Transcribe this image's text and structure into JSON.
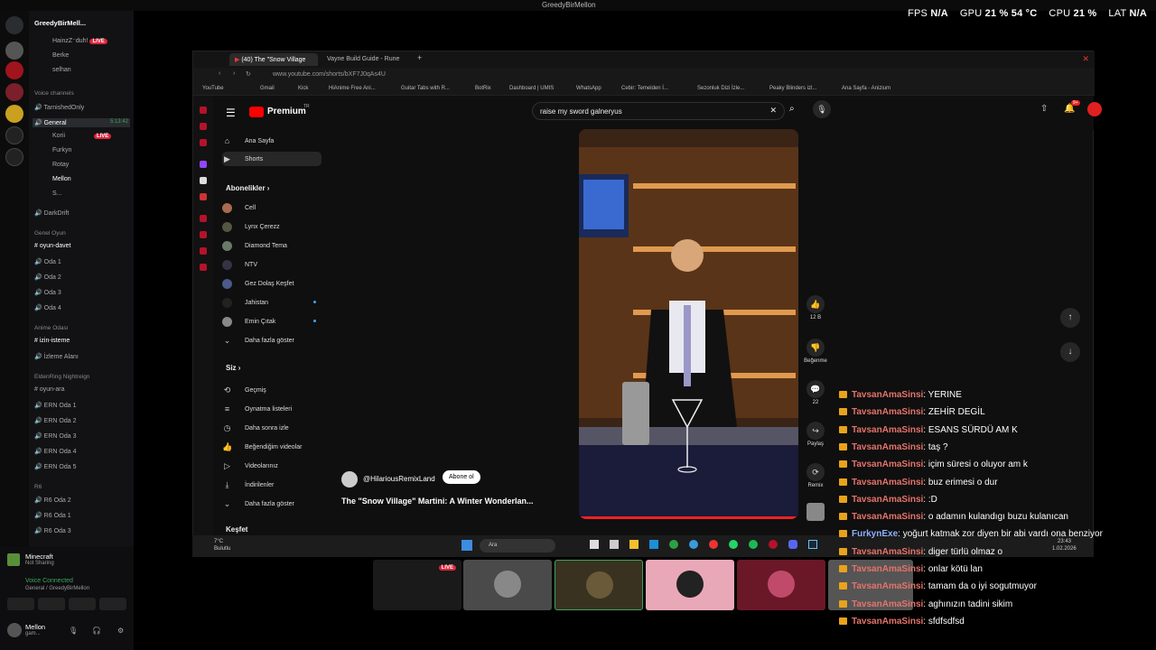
{
  "topbar": {
    "title": "GreedyBirMellon"
  },
  "stats": {
    "fps_label": "FPS",
    "fps": "N/A",
    "gpu_label": "GPU",
    "gpu": "21 % 54 °C",
    "cpu_label": "CPU",
    "cpu": "21 %",
    "lat_label": "LAT",
    "lat": "N/A"
  },
  "discord": {
    "server_name": "GreedyBirMell...",
    "top_users": [
      "HainzZ⁻duh!",
      "Berke",
      "selhan"
    ],
    "voice_section": "Voice channels",
    "channels": [
      {
        "label": "TarnishedOnly"
      },
      {
        "label": "General",
        "time": "5:13:42"
      }
    ],
    "general_users": [
      "Korii",
      "Furkyn",
      "Rotay",
      "Mellon",
      "S..."
    ],
    "sections": [
      "DarkDrift",
      "Genel Oyun",
      "oyun-davet",
      "Oda 1",
      "Oda 2",
      "Oda 3",
      "Oda 4",
      "Anime Odası",
      "izin-isteme",
      "İzleme Alanı",
      "EldenRing Nightreign",
      "oyun-ara",
      "ERN Oda 1",
      "ERN Oda 2",
      "ERN Oda 3",
      "ERN Oda 4",
      "ERN Oda 5",
      "R6",
      "R6 Oda 2",
      "R6 Oda 1",
      "R6 Oda 3"
    ],
    "activity_game": "Minecraft",
    "activity_status": "Not Sharing",
    "voice_connected": "Voice Connected",
    "voice_channel": "General / GreedyBirMellon",
    "user_name": "Mellon",
    "user_status": "gam...",
    "live_badge": "LIVE"
  },
  "browser": {
    "tab1": "(40) The \"Snow Village",
    "tab2": "Vayne Build Guide - Rune",
    "url": "www.youtube.com/shorts/bXF7J0qAs4U",
    "bookmarks": [
      "YouTube",
      "Gmail",
      "Kick",
      "HiAnime Free Ani...",
      "Guitar Tabs with R...",
      "BotRix",
      "Dashboard | UMIS",
      "WhatsApp",
      "Cebir: Temelden İ...",
      "Sezonluk Dizi İzle...",
      "Peaky Blinders izl...",
      "Ana Sayfa - Anizium"
    ]
  },
  "youtube": {
    "logo": "Premium",
    "logo_sup": "TR",
    "search_value": "raise my sword galneryus",
    "notif_count": "9+",
    "nav": [
      "Ana Sayfa",
      "Shorts"
    ],
    "subs_header": "Abonelikler",
    "subs": [
      "Cell",
      "Lynx Çerezz",
      "Diamond Tema",
      "NTV",
      "Gez Dolaş Keşfet",
      "Jahistan",
      "Emin Çıtak"
    ],
    "more1": "Daha fazla göster",
    "you_header": "Siz",
    "you_items": [
      "Geçmiş",
      "Oynatma listeleri",
      "Daha sonra izle",
      "Beğendiğim videolar",
      "Videolarınız",
      "İndirilenler"
    ],
    "more2": "Daha fazla göster",
    "explore": "Keşfet",
    "channel": "@HilariousRemixLand",
    "subscribe": "Abone ol",
    "video_title": "The \"Snow Village\" Martini: A Winter Wonderlan...",
    "likes": "12 B",
    "dislike": "Beğenme",
    "comments": "22",
    "share": "Paylaş",
    "remix": "Remix"
  },
  "chat": [
    {
      "name": "TavsanAmaSinsi",
      "msg": ": YERINE"
    },
    {
      "name": "TavsanAmaSinsi",
      "msg": ": ZEHİR DEGİL"
    },
    {
      "name": "TavsanAmaSinsi",
      "msg": ": ESANS SÜRDÜ AM K"
    },
    {
      "name": "TavsanAmaSinsi",
      "msg": ": taş ?"
    },
    {
      "name": "TavsanAmaSinsi",
      "msg": ": içim süresi o oluyor am k"
    },
    {
      "name": "TavsanAmaSinsi",
      "msg": ": buz erimesi o dur"
    },
    {
      "name": "TavsanAmaSinsi",
      "msg": ": :D"
    },
    {
      "name": "TavsanAmaSinsi",
      "msg": ": o adamın kulandıgı buzu kulanıcan"
    },
    {
      "name": "FurkynExe",
      "msg": ": yoğurt katmak zor diyen bir abi vardı ona benziyor"
    },
    {
      "name": "TavsanAmaSinsi",
      "msg": ": diger türlü olmaz o"
    },
    {
      "name": "TavsanAmaSinsi",
      "msg": ": onlar kötü lan"
    },
    {
      "name": "TavsanAmaSinsi",
      "msg": ": tamam da o iyi sogutmuyor"
    },
    {
      "name": "TavsanAmaSinsi",
      "msg": ": aghınızın tadini sikim"
    },
    {
      "name": "TavsanAmaSinsi",
      "msg": ": sfdfsdfsd"
    }
  ],
  "taskbar": {
    "weather": "7°C",
    "weather_desc": "Bulutlu",
    "search": "Ara",
    "time": "23:43",
    "date": "1.02.2026",
    "live": "LIVE"
  }
}
